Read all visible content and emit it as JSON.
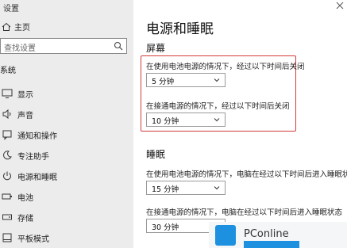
{
  "window": {
    "title": "设置"
  },
  "sidebar": {
    "home_label": "主页",
    "search_placeholder": "查找设置",
    "section_label": "系统",
    "items": [
      {
        "label": "显示",
        "icon": "monitor-icon"
      },
      {
        "label": "声音",
        "icon": "speaker-icon"
      },
      {
        "label": "通知和操作",
        "icon": "notification-icon"
      },
      {
        "label": "专注助手",
        "icon": "moon-icon"
      },
      {
        "label": "电源和睡眠",
        "icon": "power-icon",
        "active": true
      },
      {
        "label": "电池",
        "icon": "battery-icon"
      },
      {
        "label": "存储",
        "icon": "storage-icon"
      },
      {
        "label": "平板模式",
        "icon": "tablet-icon"
      }
    ]
  },
  "main": {
    "title": "电源和睡眠",
    "screen": {
      "heading": "屏幕",
      "battery_desc": "在使用电池电源的情况下，经过以下时间后关闭",
      "battery_value": "5 分钟",
      "plugged_desc": "在接通电源的情况下，经过以下时间后关闭",
      "plugged_value": "10 分钟"
    },
    "sleep": {
      "heading": "睡眠",
      "battery_desc": "在使用电池电源的情况下，电脑在经过以下时间后进入睡眠状态",
      "battery_value": "15 分钟",
      "plugged_desc": "在接通电源的情况下，电脑在经过以下时间后进入睡眠状态",
      "plugged_value": "30 分钟"
    }
  },
  "watermark": {
    "text": "PConline"
  },
  "colors": {
    "highlight": "#d23b3b",
    "sidebar_bg": "#ececec",
    "brand": "#1e90e0"
  }
}
